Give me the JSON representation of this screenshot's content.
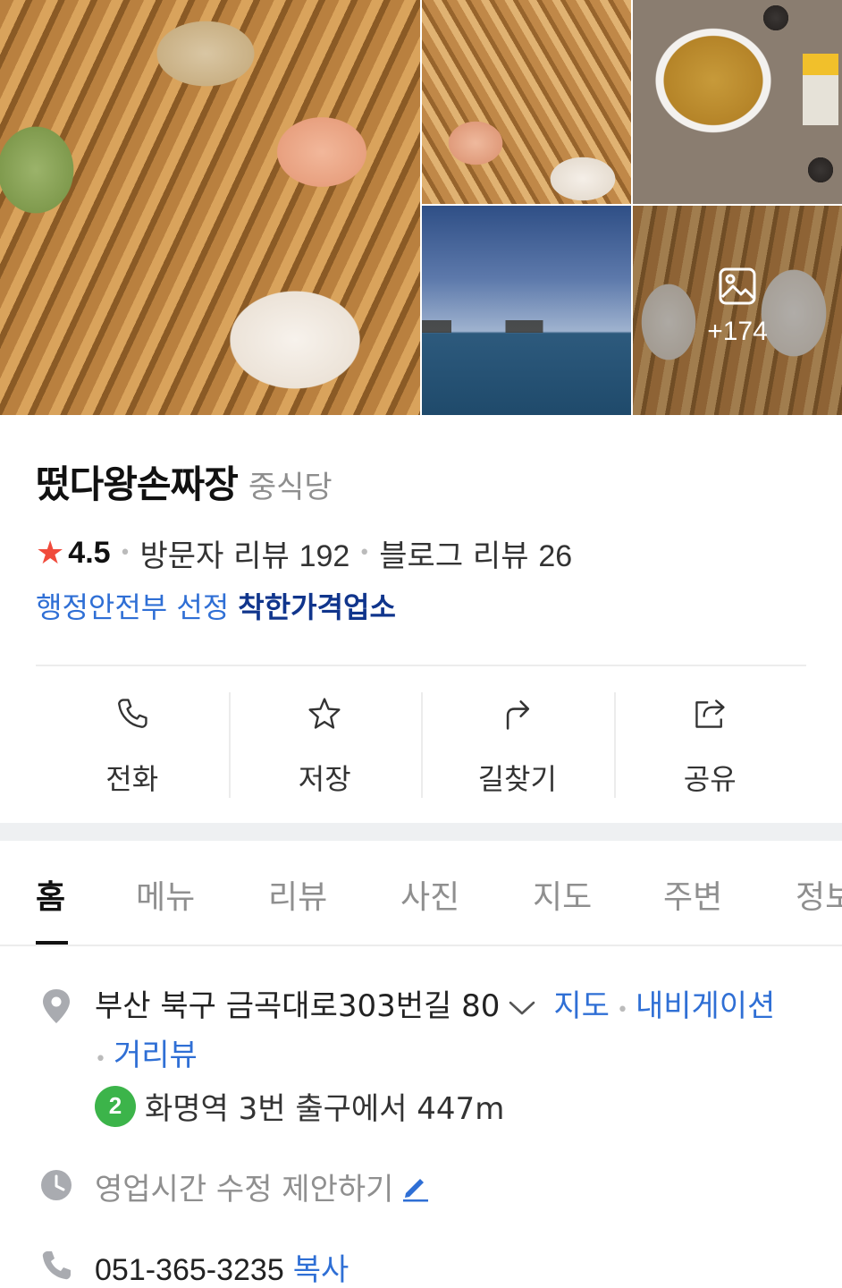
{
  "photos": {
    "more_count": "+174"
  },
  "place": {
    "name": "떴다왕손짜장",
    "category": "중식당",
    "rating": "4.5",
    "visitor_reviews_label": "방문자 리뷰",
    "visitor_reviews_count": "192",
    "blog_reviews_label": "블로그 리뷰",
    "blog_reviews_count": "26",
    "cert_prefix": "행정안전부 선정",
    "cert_main": "착한가격업소"
  },
  "actions": {
    "call": "전화",
    "save": "저장",
    "directions": "길찾기",
    "share": "공유"
  },
  "tabs": [
    "홈",
    "메뉴",
    "리뷰",
    "사진",
    "지도",
    "주변",
    "정보"
  ],
  "info": {
    "address": "부산 북구 금곡대로303번길 80",
    "map_link": "지도",
    "navigation_link": "내비게이션",
    "street_view_link": "거리뷰",
    "subway_line": "2",
    "subway_text": "화명역 3번 출구에서 447m",
    "hours_suggest": "영업시간 수정 제안하기",
    "phone": "051-365-3235",
    "copy_label": "복사"
  }
}
